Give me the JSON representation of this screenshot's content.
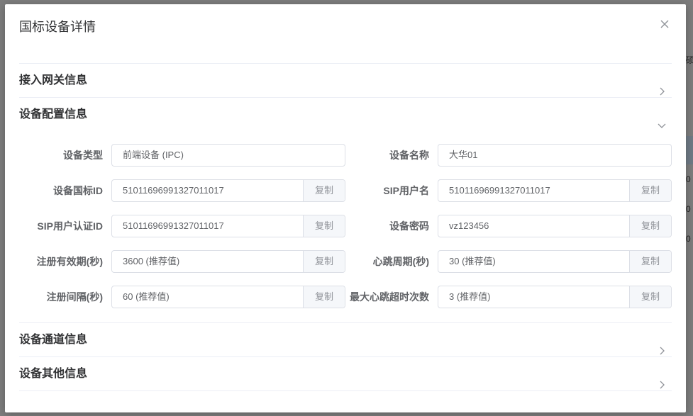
{
  "background": {
    "right_edge_fragments": [
      "硕",
      "0",
      "0",
      "0"
    ]
  },
  "dialog": {
    "title": "国标设备详情",
    "close_icon": "close-icon"
  },
  "sections": [
    {
      "title": "接入网关信息",
      "expanded": false,
      "arrow_icon": "chevron-right-icon"
    },
    {
      "title": "设备配置信息",
      "expanded": true,
      "arrow_icon": "chevron-down-icon"
    },
    {
      "title": "设备通道信息",
      "expanded": false,
      "arrow_icon": "chevron-right-icon"
    },
    {
      "title": "设备其他信息",
      "expanded": false,
      "arrow_icon": "chevron-right-icon"
    }
  ],
  "config": {
    "copy_label": "复制",
    "fields": {
      "device_type": {
        "label": "设备类型",
        "value": "前端设备 (IPC)"
      },
      "device_name": {
        "label": "设备名称",
        "value": "大华01"
      },
      "gb_id": {
        "label": "设备国标ID",
        "value": "51011696991327011017"
      },
      "sip_user": {
        "label": "SIP用户名",
        "value": "51011696991327011017"
      },
      "sip_auth_id": {
        "label": "SIP用户认证ID",
        "value": "51011696991327011017"
      },
      "password": {
        "label": "设备密码",
        "value": "vz123456"
      },
      "reg_validity": {
        "label": "注册有效期(秒)",
        "value": "3600 (推荐值)"
      },
      "heartbeat_period": {
        "label": "心跳周期(秒)",
        "value": "30 (推荐值)"
      },
      "reg_interval": {
        "label": "注册间隔(秒)",
        "value": "60 (推荐值)"
      },
      "max_heartbeat_timeouts": {
        "label": "最大心跳超时次数",
        "value": "3 (推荐值)"
      }
    }
  },
  "colors": {
    "border": "#dcdfe6",
    "divider": "#ebeef5",
    "text_primary": "#303133",
    "text_regular": "#606266",
    "text_secondary": "#909399",
    "copy_bg": "#f5f7fa"
  }
}
